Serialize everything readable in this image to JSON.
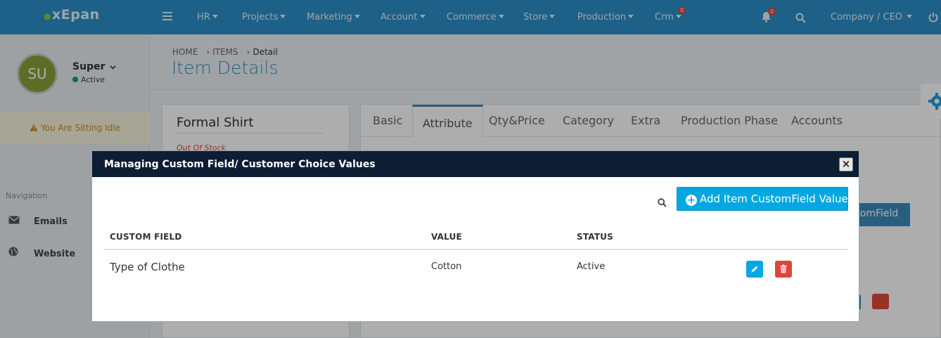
{
  "app": {
    "logo": "xEpan"
  },
  "topnav": {
    "menus": [
      "HR",
      "Projects",
      "Marketing",
      "Account",
      "Commerce",
      "Store",
      "Production",
      "Crm"
    ],
    "crm_badge": "0",
    "notification_badge": "0",
    "user_menu": "Company / CEO",
    "icons": [
      "hamburger-icon",
      "bell-icon",
      "search-icon",
      "power-icon"
    ]
  },
  "sidebar": {
    "avatar_initials": "SU",
    "user_name": "Super",
    "user_status": "Active",
    "idle_message": "You Are Sitting Idle",
    "nav_title": "Navigation",
    "items": [
      {
        "label": "Emails",
        "icon": "envelope-icon"
      },
      {
        "label": "Website",
        "icon": "globe-icon"
      }
    ]
  },
  "breadcrumb": [
    "HOME",
    "ITEMS",
    "Detail"
  ],
  "page_title": "Item Details",
  "item": {
    "name": "Formal Shirt",
    "stock_status": "Out Of Stock"
  },
  "tabs": [
    "Basic",
    "Attribute",
    "Qty&Price",
    "Category",
    "Extra",
    "Production Phase",
    "Accounts"
  ],
  "active_tab": "Attribute",
  "background": {
    "partial_button_label": "stomField"
  },
  "modal": {
    "title": "Managing Custom Field/ Customer Choice Values",
    "close_label": "×",
    "add_button_label": "Add Item CustomField Value",
    "columns": [
      "CUSTOM FIELD",
      "VALUE",
      "STATUS"
    ],
    "rows": [
      {
        "custom_field": "Type of Clothe",
        "value": "Cotton",
        "status": "Active"
      }
    ]
  },
  "colors": {
    "header": "#2c8fc9",
    "modal_header": "#0d1d33",
    "primary_button": "#00a7e1",
    "danger": "#e0443a"
  }
}
